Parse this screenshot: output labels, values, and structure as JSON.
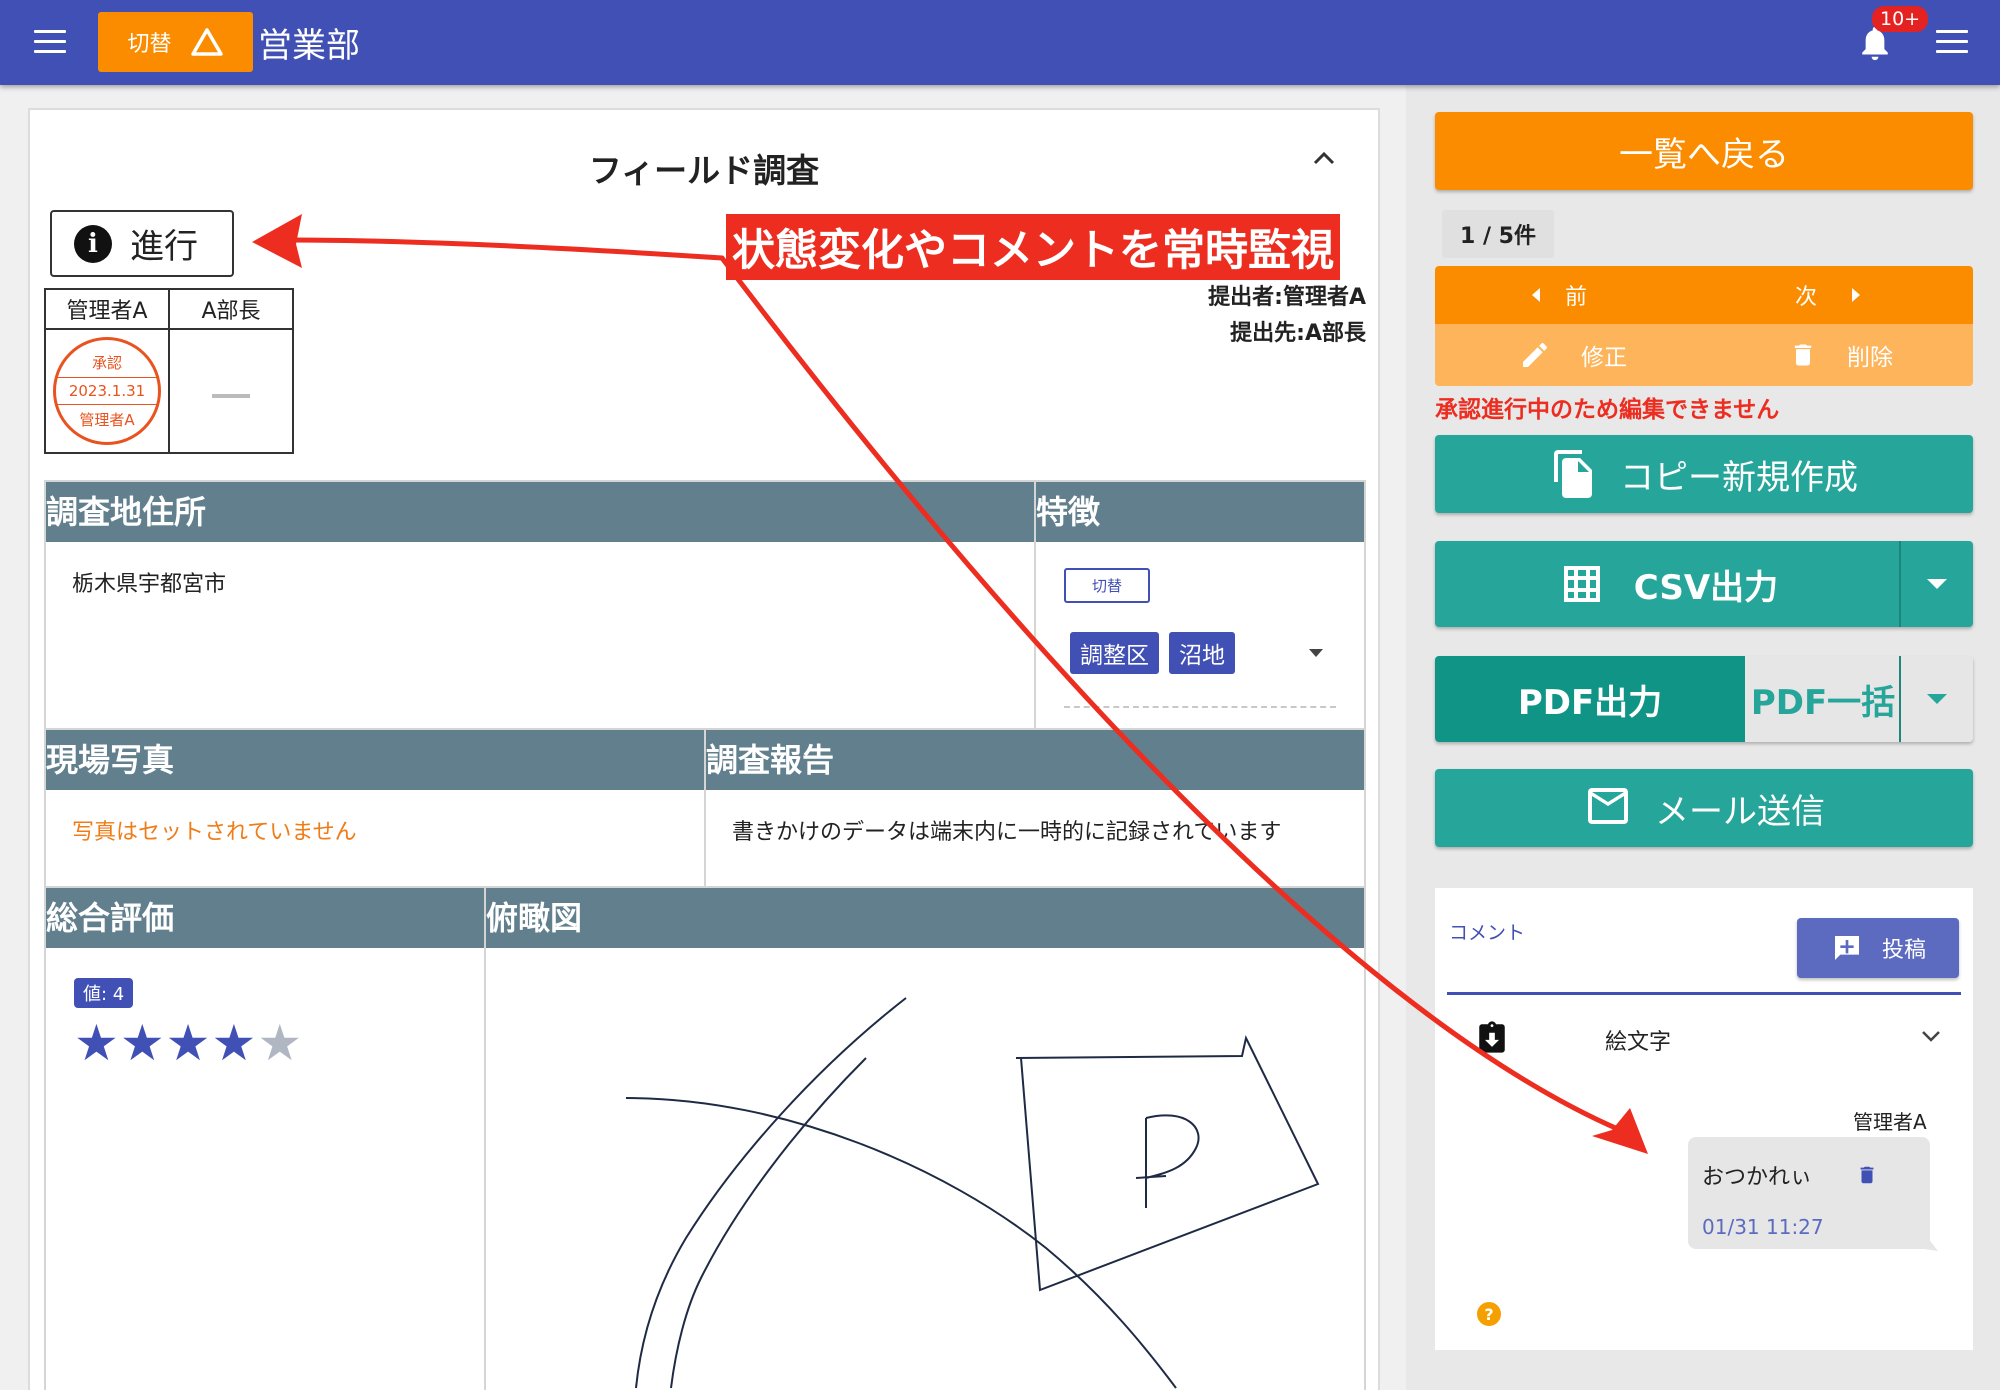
{
  "header": {
    "switch_label": "切替",
    "department": "営業部",
    "notification_count": "10+"
  },
  "form": {
    "title": "フィールド調査",
    "status_label": "進行",
    "approval": {
      "headers": [
        "管理者A",
        "A部長"
      ],
      "stamp": {
        "top": "承認",
        "date": "2023.1.31",
        "name": "管理者A"
      }
    },
    "submitter": "提出者:管理者A",
    "recipient": "提出先:A部長",
    "sections": {
      "address": {
        "title": "調査地住所",
        "value": "栃木県宇都宮市"
      },
      "features": {
        "title": "特徴",
        "switch_label": "切替",
        "tags": [
          "調整区",
          "沼地"
        ]
      },
      "photos": {
        "title": "現場写真",
        "empty_text": "写真はセットされていません"
      },
      "report": {
        "title": "調査報告",
        "value": "書きかけのデータは端末内に一時的に記録されています"
      },
      "rating": {
        "title": "総合評価",
        "value_label": "値: 4",
        "value": 4,
        "max": 5
      },
      "overview": {
        "title": "俯瞰図"
      }
    }
  },
  "annotation": {
    "label": "状態変化やコメントを常時監視",
    "color": "#ec2d20"
  },
  "sidebar": {
    "back_label": "一覧へ戻る",
    "page_count": "1 / 5件",
    "prev_label": "前",
    "next_label": "次",
    "edit_label": "修正",
    "delete_label": "削除",
    "warning": "承認進行中のため編集できません",
    "copy_label": "コピー新規作成",
    "csv_label": "CSV出力",
    "pdf_label": "PDF出力",
    "pdf_bulk_label": "PDF一括",
    "mail_label": "メール送信"
  },
  "comments": {
    "label": "コメント",
    "post_label": "投稿",
    "emoji_label": "絵文字",
    "items": [
      {
        "author": "管理者A",
        "text": "おつかれぃ",
        "time": "01/31 11:27"
      }
    ]
  },
  "colors": {
    "header": "#4150b5",
    "accent_orange": "#fb8c00",
    "teal": "#26a69a",
    "section_header": "#627f8e"
  }
}
